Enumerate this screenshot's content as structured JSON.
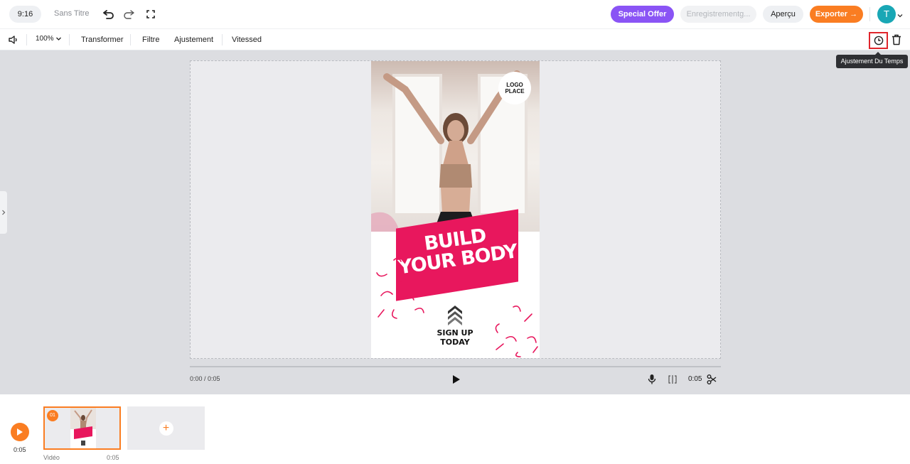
{
  "header": {
    "aspect_ratio": "9:16",
    "doc_title": "Sans Titre",
    "special_offer_label": "Special Offer",
    "saving_status": "Enregistrementg...",
    "preview_label": "Aperçu",
    "export_label": "Exporter →",
    "avatar_initial": "T"
  },
  "toolbar": {
    "zoom": "100%",
    "items": [
      "Transformer",
      "Filtre",
      "Ajustement",
      "Vitessed"
    ],
    "tooltip": "Ajustement Du Temps"
  },
  "canvas": {
    "logo_line1": "LOGO",
    "logo_line2": "PLACE",
    "banner_line1": "BUILD",
    "banner_line2": "YOUR BODY",
    "signup_line1": "SIGN UP",
    "signup_line2": "TODAY"
  },
  "player": {
    "time_current": "0:00 / 0:05",
    "duration": "0:05"
  },
  "timeline": {
    "total_time": "0:05",
    "clips": [
      {
        "badge": "01",
        "label": "Vidéo",
        "duration": "0:05"
      }
    ],
    "add_label": "+"
  },
  "colors": {
    "accent_orange": "#fa7d22",
    "offer_purple": "#8a54f5",
    "brand_pink": "#e8175d",
    "avatar_teal": "#19a7b5",
    "highlight_red": "#e0252b"
  }
}
